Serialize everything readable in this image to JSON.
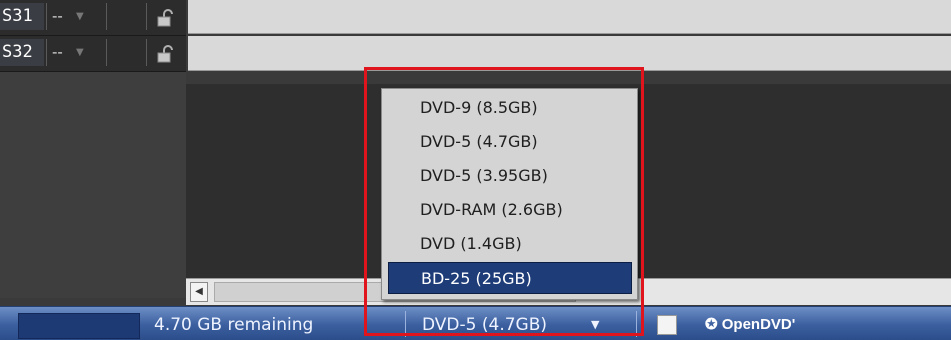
{
  "tracks": [
    {
      "name": "S31",
      "value": "--"
    },
    {
      "name": "S32",
      "value": "--"
    }
  ],
  "disc_menu": {
    "options": [
      "DVD-9 (8.5GB)",
      "DVD-5 (4.7GB)",
      "DVD-5 (3.95GB)",
      "DVD-RAM (2.6GB)",
      "DVD (1.4GB)",
      "BD-25 (25GB)"
    ],
    "highlighted_index": 5
  },
  "status": {
    "remaining": "4.70 GB remaining",
    "disc_selected": "DVD-5 (4.7GB)",
    "logo": "OpenDVD'"
  },
  "colors": {
    "highlight_border": "#e0141c",
    "selection": "#1d3c78",
    "status_bar": "#3b5f9f"
  },
  "icons": {
    "lock": "lock-icon",
    "scroll_left": "arrow-left-icon",
    "dropdown_arrow": "chevron-down-icon",
    "logo": "opendvd-logo-icon"
  }
}
